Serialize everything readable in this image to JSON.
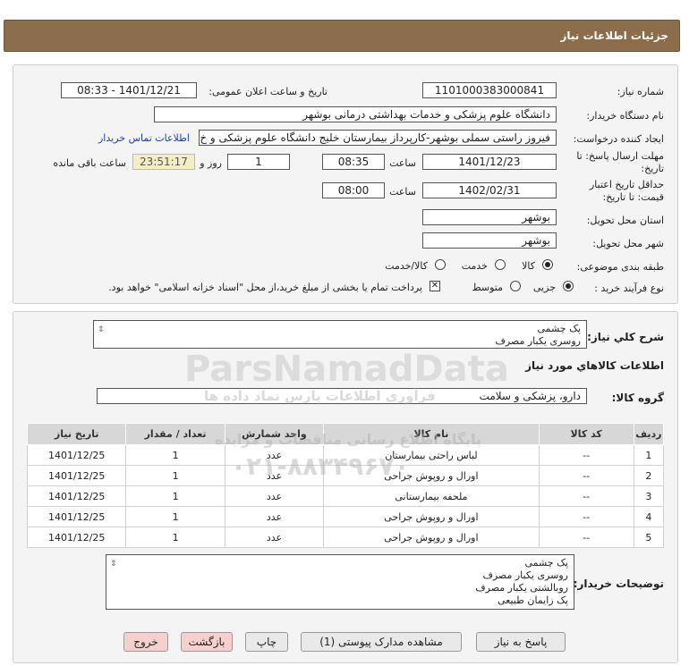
{
  "header": {
    "title": "جزئیات اطلاعات نیاز"
  },
  "form": {
    "need_number_label": "شماره نیاز:",
    "need_number": "1101000383000841",
    "announce_label": "تاریخ و ساعت اعلان عمومی:",
    "announce_value": "1401/12/21 - 08:33",
    "buyer_org_label": "نام دستگاه خریدار:",
    "buyer_org": "دانشگاه علوم پزشکی و خدمات بهداشتی درمانی بوشهر",
    "creator_label": "ایجاد کننده درخواست:",
    "creator": "فیروز راستی سملی بوشهر-کارپرداز بیمارستان خلیج دانشگاه علوم پزشکی و خ",
    "contact_link": "اطلاعات تماس خریدار",
    "deadline_label_1": "مهلت ارسال پاسخ: تا",
    "deadline_label_2": "تاریخ:",
    "deadline_date": "1401/12/23",
    "time_label": "ساعت",
    "deadline_time": "08:35",
    "days_value": "1",
    "days_label": "روز و",
    "remaining_time": "23:51:17",
    "remaining_label": "ساعت باقی مانده",
    "validity_label_1": "حداقل تاریخ اعتبار",
    "validity_label_2": "قیمت: تا تاریخ:",
    "validity_date": "1402/02/31",
    "validity_time_label": "ساعت",
    "validity_time": "08:00",
    "province_label": "استان محل تحویل:",
    "province": "بوشهر",
    "city_label": "شهر محل تحویل:",
    "city": "بوشهر",
    "category_label": "طبقه بندی موضوعی:",
    "category_options": [
      "کالا",
      "خدمت",
      "کالا/خدمت"
    ],
    "process_label": "نوع فرآیند خرید :",
    "process_options": [
      "جزیی",
      "متوسط"
    ],
    "payment_note": "پرداخت تمام یا بخشی از مبلغ خرید،از محل \"اسناد خزانه اسلامی\" خواهد بود."
  },
  "summary": {
    "label": "شرح کلي نياز:",
    "lines": [
      "پک چشمی",
      "روسری یکبار مصرف"
    ]
  },
  "goods": {
    "section_title": "اطلاعات کالاهاي مورد نياز",
    "group_label": "گروه کالا:",
    "group_value": "دارو، پزشکی و سلامت"
  },
  "table": {
    "headers": [
      "ردیف",
      "کد کالا",
      "نام کالا",
      "واحد شمارش",
      "تعداد / مقدار",
      "تاریخ نیاز"
    ],
    "rows": [
      [
        "1",
        "--",
        "لباس راحتی بیمارستان",
        "عدد",
        "1",
        "1401/12/25"
      ],
      [
        "2",
        "--",
        "اورال و روپوش جراحی",
        "عدد",
        "1",
        "1401/12/25"
      ],
      [
        "3",
        "--",
        "ملحفه بیمارستانی",
        "عدد",
        "1",
        "1401/12/25"
      ],
      [
        "4",
        "--",
        "اورال و روپوش جراحی",
        "عدد",
        "1",
        "1401/12/25"
      ],
      [
        "5",
        "--",
        "اورال و روپوش جراحی",
        "عدد",
        "1",
        "1401/12/25"
      ]
    ]
  },
  "buyer_notes": {
    "label": "توضیحات خریدار:",
    "lines": [
      "پک چشمی",
      "روسری یکبار مصرف",
      "روبالشتی یکبار مصرف",
      "پک زایمان طبیعی"
    ]
  },
  "buttons": {
    "reply": "پاسخ به نیاز",
    "docs": "مشاهده مدارک پیوستی (1)",
    "print": "چاپ",
    "back": "بازگشت",
    "exit": "خروج"
  },
  "watermark": {
    "brand": "ParsNamadData",
    "line1": "پایگاه اطلاع رسانی مناقصات و مزایده",
    "line2": "فرآوری اطلاعات پارس نماد داده ها",
    "phone": "۰۲۱-۸۸۳۴۹۶۷۰"
  }
}
